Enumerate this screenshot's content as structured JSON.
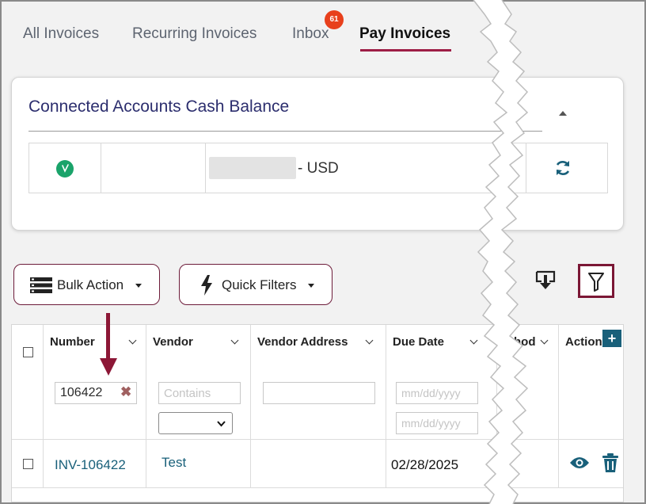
{
  "tabs": [
    {
      "label": "All Invoices"
    },
    {
      "label": "Recurring Invoices"
    },
    {
      "label": "Inbox",
      "badge": "61"
    },
    {
      "label": "Pay Invoices",
      "active": true
    }
  ],
  "cash_balance": {
    "title": "Connected Accounts Cash Balance",
    "currency": "- USD"
  },
  "toolbar": {
    "bulk_action": "Bulk Action",
    "quick_filters": "Quick Filters"
  },
  "table": {
    "columns": [
      "Number",
      "Vendor",
      "Vendor Address",
      "Due Date",
      "hod",
      "Action"
    ],
    "filters": {
      "number_value": "106422",
      "vendor_placeholder": "Contains",
      "due_date_from_placeholder": "mm/dd/yyyy",
      "due_date_to_placeholder": "mm/dd/yyyy"
    },
    "rows": [
      {
        "number": "INV-106422",
        "vendor": "Test",
        "due_date": "02/28/2025"
      }
    ]
  },
  "colors": {
    "accent": "#9d1e46",
    "tab_text": "#5d6470",
    "link": "#19607a",
    "badge": "#e8401c",
    "logo": "#1aa36a",
    "card_title": "#2c2e6e"
  }
}
